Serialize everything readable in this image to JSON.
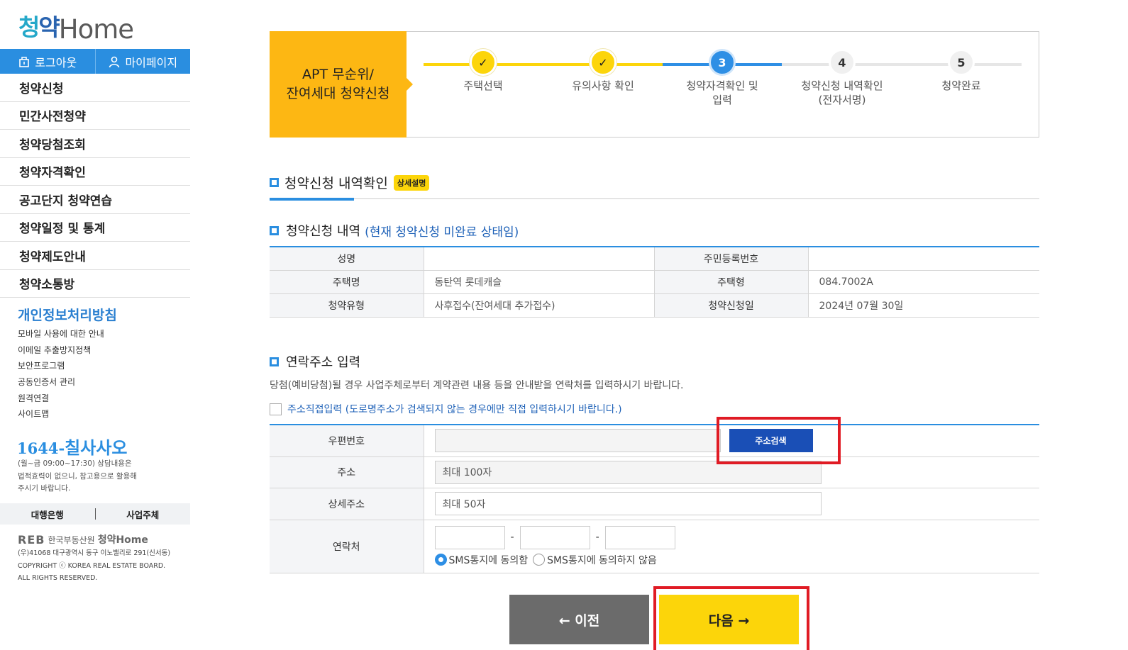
{
  "logo": {
    "text_a": "청",
    "text_b": "약",
    "text_c": "Home"
  },
  "topbar": {
    "logout": "로그아웃",
    "mypage": "마이페이지"
  },
  "menu": [
    "청약신청",
    "민간사전청약",
    "청약당첨조회",
    "청약자격확인",
    "공고단지 청약연습",
    "청약일정 및 통계",
    "청약제도안내",
    "청약소통방"
  ],
  "privacy": {
    "title": "개인정보처리방침",
    "links": [
      "모바일 사용에 대한 안내",
      "이메일 추출방지정책",
      "보안프로그램",
      "공동인증서 관리",
      "원격연결",
      "사이트맵"
    ]
  },
  "phone": {
    "prefix": "1644-",
    "name": "칠사사오",
    "note1": "(월~금 09:00~17:30) 상담내용은",
    "note2": "법적효력이 없으니, 참고용으로 활용해",
    "note3": "주시기 바랍니다."
  },
  "bankbar": {
    "bank": "대행은행",
    "builder": "사업주체"
  },
  "footer": {
    "reb": "REB",
    "org": "한국부동산원",
    "home": "청약Home",
    "addr": "(우)41068 대구광역시 동구 이노밸리로 291(신서동)",
    "copy1": "COPYRIGHT ⓒ KOREA REAL ESTATE BOARD.",
    "copy2": "ALL RIGHTS RESERVED."
  },
  "apt_box": {
    "line1": "APT 무순위/",
    "line2": "잔여세대 청약신청"
  },
  "steps": [
    {
      "mark": "✓",
      "label1": "주택선택",
      "label2": "",
      "state": "done"
    },
    {
      "mark": "✓",
      "label1": "유의사항 확인",
      "label2": "",
      "state": "done"
    },
    {
      "mark": "3",
      "label1": "청약자격확인 및",
      "label2": "입력",
      "state": "current"
    },
    {
      "mark": "4",
      "label1": "청약신청 내역확인",
      "label2": "(전자서명)",
      "state": "todo"
    },
    {
      "mark": "5",
      "label1": "청약완료",
      "label2": "",
      "state": "todo"
    }
  ],
  "section": {
    "title": "청약신청 내역확인",
    "badge": "상세설명"
  },
  "history": {
    "title": "청약신청 내역",
    "note": "(현재 청약신청 미완료 상태임)",
    "rows": [
      {
        "k1": "성명",
        "v1": "",
        "k2": "주민등록번호",
        "v2": ""
      },
      {
        "k1": "주택명",
        "v1": "동탄역 롯데캐슬",
        "k2": "주택형",
        "v2": "084.7002A"
      },
      {
        "k1": "청약유형",
        "v1": "사후접수(잔여세대 추가접수)",
        "k2": "청약신청일",
        "v2": "2024년 07월 30일"
      }
    ]
  },
  "contact": {
    "title": "연락주소 입력",
    "desc": "당첨(예비당첨)될 경우 사업주체로부터 계약관련 내용 등을 안내받을 연락처를 입력하시기 바랍니다.",
    "direct": "주소직접입력 (도로명주소가 검색되지 않는 경우에만 직접 입력하시기 바랍니다.)",
    "zip_label": "우편번호",
    "search_btn": "주소검색",
    "addr_label": "주소",
    "addr_placeholder": "최대 100자",
    "detail_label": "상세주소",
    "detail_placeholder": "최대 50자",
    "phone_label": "연락처",
    "dash": "-",
    "sms_agree": "SMS통지에 동의함",
    "sms_disagree": "SMS통지에 동의하지 않음"
  },
  "buttons": {
    "prev": "← 이전",
    "next": "다음 →"
  },
  "colors": {
    "accent": "#2a8ee0",
    "yellow": "#fcd50a",
    "orange": "#fdb713",
    "highlight": "#e01b24"
  }
}
